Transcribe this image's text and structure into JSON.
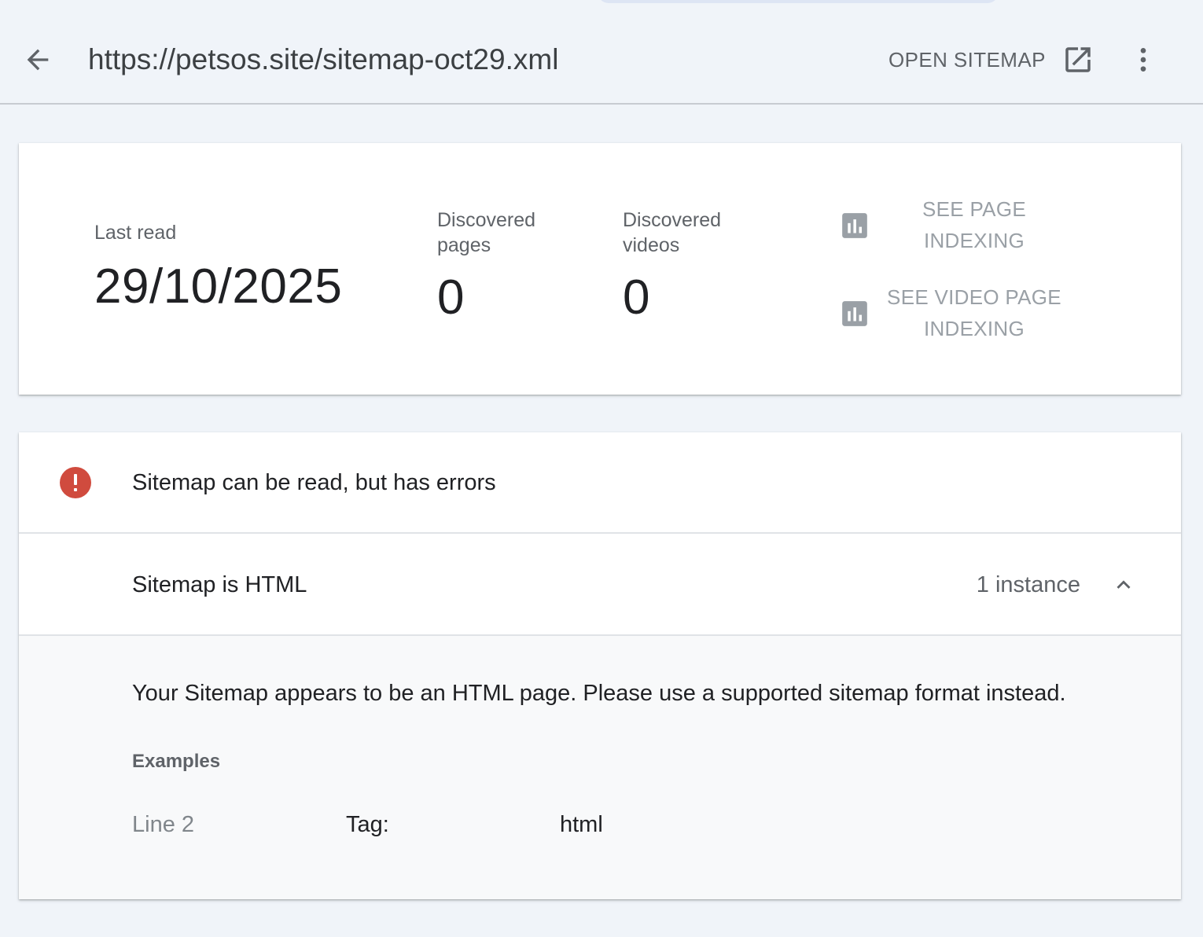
{
  "header": {
    "url": "https://petsos.site/sitemap-oct29.xml",
    "open_sitemap_label": "OPEN SITEMAP",
    "icons": {
      "back": "arrow-back-icon",
      "open": "open-in-new-icon",
      "more": "more-vert-icon"
    }
  },
  "summary": {
    "last_read_label": "Last read",
    "last_read_value": "29/10/2025",
    "discovered_pages_label": "Discovered pages",
    "discovered_pages_value": "0",
    "discovered_videos_label": "Discovered videos",
    "discovered_videos_value": "0",
    "links": [
      {
        "label": "SEE PAGE INDEXING",
        "icon": "bar-chart-icon"
      },
      {
        "label": "SEE VIDEO PAGE INDEXING",
        "icon": "bar-chart-icon"
      }
    ]
  },
  "status": {
    "icon": "error-icon",
    "message": "Sitemap can be read, but has errors",
    "color": "#d04b3e"
  },
  "issue": {
    "title": "Sitemap is HTML",
    "count": "1 instance",
    "expanded": true,
    "description": "Your Sitemap appears to be an HTML page. Please use a supported sitemap format instead.",
    "examples_label": "Examples",
    "examples": [
      {
        "line": "Line 2",
        "tag_label": "Tag:",
        "tag_value": "html"
      }
    ]
  },
  "colors": {
    "page_background": "#f0f4f9",
    "card_background": "#ffffff",
    "details_background": "#f8f9fa",
    "muted_text": "#5f6368",
    "link_text": "#9aa0a6"
  }
}
